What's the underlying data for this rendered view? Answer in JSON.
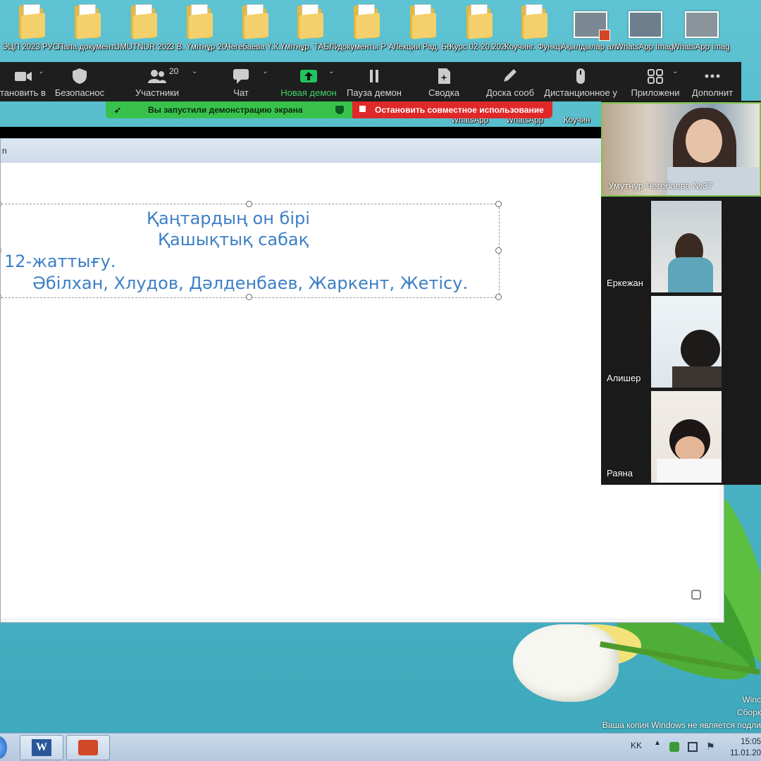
{
  "desktop": {
    "icons": [
      {
        "label": "ЭЦП 2023 РУСЛА...",
        "kind": "folder"
      },
      {
        "label": "Папа документ...",
        "kind": "folder"
      },
      {
        "label": "UMUTNUR 2023",
        "kind": "folder"
      },
      {
        "label": "3 В. Үмітнұр 2023-2024",
        "kind": "folder"
      },
      {
        "label": "Чегебаева Ү.К. 5 құжат",
        "kind": "folder"
      },
      {
        "label": "Үмітнұр. ТАБЛИЦ...",
        "kind": "folder"
      },
      {
        "label": "документы Р А",
        "kind": "folder"
      },
      {
        "label": "Лекции Рад. Без",
        "kind": "folder"
      },
      {
        "label": "Курс 02-20.2023",
        "kind": "folder"
      },
      {
        "label": "Коучинг. Функцион...",
        "kind": "folder"
      },
      {
        "label": "Ақылдылар аланы.pptx",
        "kind": "pptx"
      },
      {
        "label": "WhatsApp Image 2023...",
        "kind": "image"
      },
      {
        "label": "WhatsApp Image 2023...",
        "kind": "image"
      }
    ],
    "hidden_icon_labels": [
      "WhatsApp",
      "WhatsApp",
      "Коучин"
    ]
  },
  "toolbar": {
    "stop_video": "тановить в",
    "security": "Безопаснос",
    "participants": "Участники",
    "participants_count": "20",
    "chat": "Чат",
    "new_share": "Новая демон",
    "pause_share": "Пауза демон",
    "summary": "Сводка",
    "annotate": "Доска сооб",
    "remote_control": "Дистанционное у",
    "apps": "Приложени",
    "more": "Дополнит"
  },
  "share_banner": {
    "started": "Вы запустили демонстрацию экрана",
    "stop": "Остановить совместное использование"
  },
  "slide_window": {
    "title_fragment": "n",
    "lines": [
      "Қаңтардың он бірі",
      "Қашықтық сабақ",
      "12-жаттығу.",
      "Әбілхан, Хлудов, Дәлденбаев, Жаркент, Жетісу."
    ]
  },
  "participants": [
    {
      "name": "Умутнур Чегебаева №37"
    },
    {
      "name": "Еркежан"
    },
    {
      "name": "Алишер"
    },
    {
      "name": "Раяна"
    }
  ],
  "watermark": {
    "line1": "Winc",
    "line2": "Сборк",
    "line3": "Ваша копия Windows не является подли"
  },
  "taskbar": {
    "language": "KK",
    "time": "15:05",
    "date": "11.01.20"
  },
  "colors": {
    "desktop": "#4fb8c9",
    "toolbar": "#1e1e1e",
    "share_green": "#38c24c",
    "share_red": "#e02828",
    "slide_text": "#3d7fc6",
    "new_share_accent": "#22c35e"
  }
}
